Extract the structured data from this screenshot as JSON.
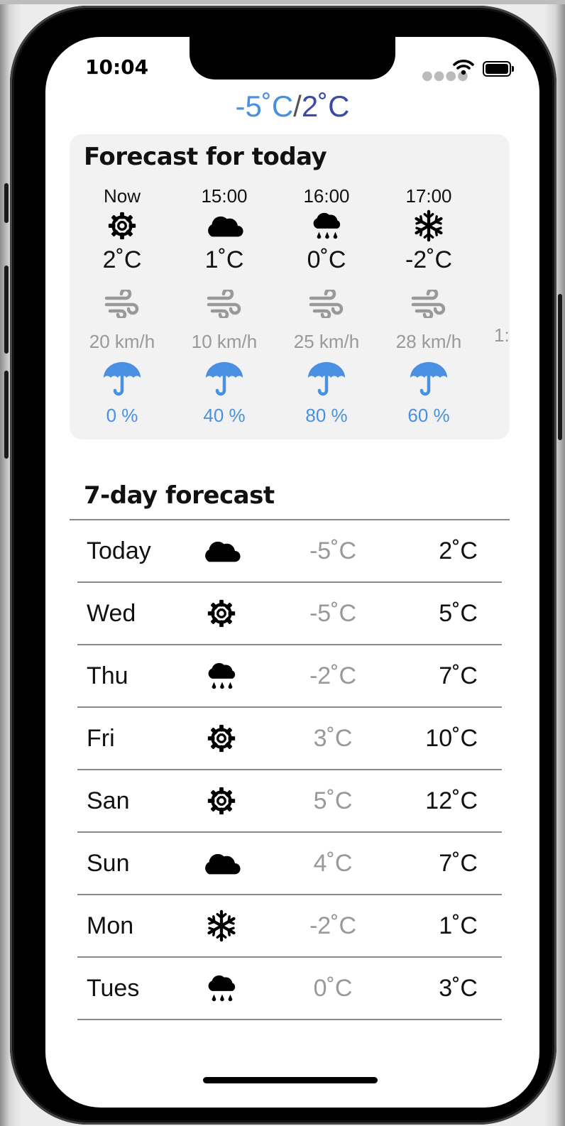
{
  "status_bar": {
    "time": "10:04",
    "signal_icon": "signal-dots-icon",
    "wifi_icon": "wifi-icon",
    "battery_icon": "battery-icon"
  },
  "headline": {
    "low": "-5˚C",
    "separator": "/",
    "high": "2˚C"
  },
  "colors": {
    "accent_blue": "#4a90e2",
    "accent_indigo": "#3b4ba8",
    "muted_gray": "#999999",
    "card_bg": "#f2f2f2"
  },
  "today": {
    "title": "Forecast for today",
    "hours": [
      {
        "label": "Now",
        "icon": "sun-icon",
        "temp": "2˚C",
        "wind": "20 km/h",
        "rain": "0 %"
      },
      {
        "label": "15:00",
        "icon": "cloud-icon",
        "temp": "1˚C",
        "wind": "10 km/h",
        "rain": "40 %"
      },
      {
        "label": "16:00",
        "icon": "rain-cloud-icon",
        "temp": "0˚C",
        "wind": "25 km/h",
        "rain": "80 %"
      },
      {
        "label": "17:00",
        "icon": "snowflake-icon",
        "temp": "-2˚C",
        "wind": "28 km/h",
        "rain": "60 %"
      }
    ],
    "peek_wind": "1:"
  },
  "week": {
    "title": "7-day forecast",
    "days": [
      {
        "name": "Today",
        "icon": "cloud-icon",
        "low": "-5˚C",
        "high": "2˚C"
      },
      {
        "name": "Wed",
        "icon": "sun-icon",
        "low": "-5˚C",
        "high": "5˚C"
      },
      {
        "name": "Thu",
        "icon": "rain-cloud-icon",
        "low": "-2˚C",
        "high": "7˚C"
      },
      {
        "name": "Fri",
        "icon": "sun-icon",
        "low": "3˚C",
        "high": "10˚C"
      },
      {
        "name": "San",
        "icon": "sun-icon",
        "low": "5˚C",
        "high": "12˚C"
      },
      {
        "name": "Sun",
        "icon": "cloud-icon",
        "low": "4˚C",
        "high": "7˚C"
      },
      {
        "name": "Mon",
        "icon": "snowflake-icon",
        "low": "-2˚C",
        "high": "1˚C"
      },
      {
        "name": "Tues",
        "icon": "rain-cloud-icon",
        "low": "0˚C",
        "high": "3˚C"
      }
    ]
  }
}
